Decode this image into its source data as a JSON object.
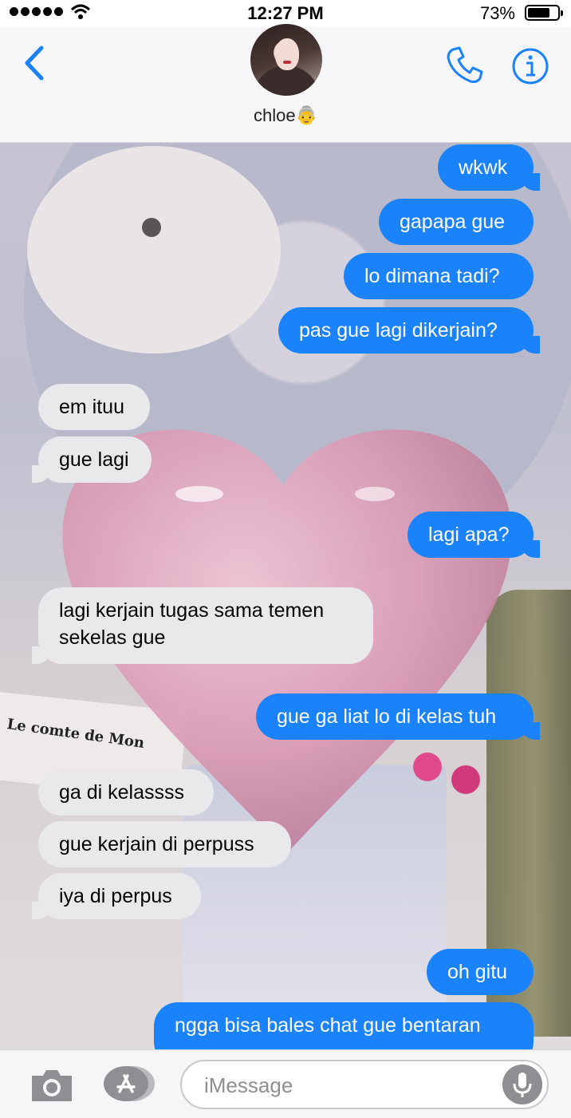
{
  "status_bar": {
    "time": "12:27 PM",
    "battery": "73%",
    "battery_level": 0.73
  },
  "header": {
    "contact_name": "chloe👵"
  },
  "messages": [
    {
      "text": "wkwk",
      "from": "me"
    },
    {
      "text": "gapapa gue",
      "from": "me"
    },
    {
      "text": "lo dimana tadi?",
      "from": "me"
    },
    {
      "text": "pas gue lagi dikerjain?",
      "from": "me"
    },
    {
      "text": "em ituu",
      "from": "them"
    },
    {
      "text": "gue lagi",
      "from": "them"
    },
    {
      "text": "lagi apa?",
      "from": "me"
    },
    {
      "text": "lagi kerjain tugas sama temen",
      "text2": "sekelas gue",
      "from": "them"
    },
    {
      "text": "gue ga liat lo di kelas tuh",
      "from": "me"
    },
    {
      "text": "ga di kelassss",
      "from": "them"
    },
    {
      "text": "gue kerjain di perpuss",
      "from": "them"
    },
    {
      "text": "iya di perpus",
      "from": "them"
    },
    {
      "text": "oh gitu",
      "from": "me"
    },
    {
      "text": "ngga bisa bales chat gue bentaran",
      "from": "me"
    }
  ],
  "background": {
    "book_text": "Le comte de Mon"
  },
  "composer": {
    "placeholder": "iMessage"
  },
  "colors": {
    "sent": "#1a82fb",
    "received": "#e9e9eb",
    "accent": "#1a82fb"
  }
}
